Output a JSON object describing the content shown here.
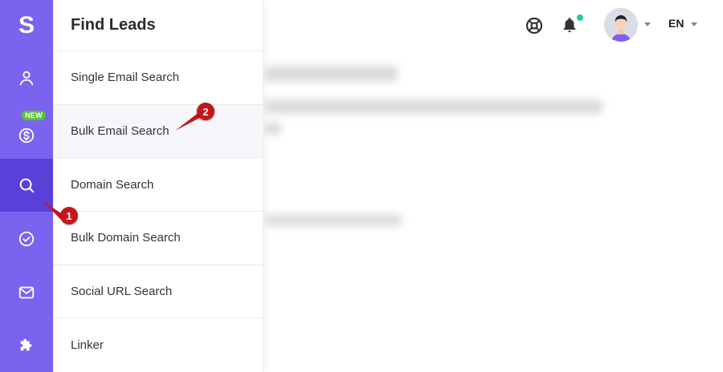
{
  "app": {
    "logo_letter": "S"
  },
  "rail": {
    "items": [
      {
        "name": "profile",
        "icon": "user-icon"
      },
      {
        "name": "credits",
        "icon": "dollar-circle-icon",
        "badge": "NEW"
      },
      {
        "name": "find-leads",
        "icon": "search-icon",
        "active": true
      },
      {
        "name": "verify",
        "icon": "check-circle-icon"
      },
      {
        "name": "email",
        "icon": "mail-icon"
      },
      {
        "name": "integrations",
        "icon": "puzzle-icon"
      }
    ]
  },
  "submenu": {
    "title": "Find Leads",
    "items": [
      {
        "label": "Single Email Search"
      },
      {
        "label": "Bulk Email Search"
      },
      {
        "label": "Domain Search"
      },
      {
        "label": "Bulk Domain Search"
      },
      {
        "label": "Social URL Search"
      },
      {
        "label": "Linker"
      }
    ]
  },
  "header": {
    "language": "EN",
    "icons": [
      "support-icon",
      "bell-icon"
    ]
  },
  "annotations": [
    {
      "label": "1"
    },
    {
      "label": "2"
    }
  ],
  "colors": {
    "rail": "#7b63ef",
    "rail_active": "#5b3fd9",
    "badge": "#5ac335",
    "notif_dot": "#22c9a5",
    "marker": "#c4161c"
  }
}
